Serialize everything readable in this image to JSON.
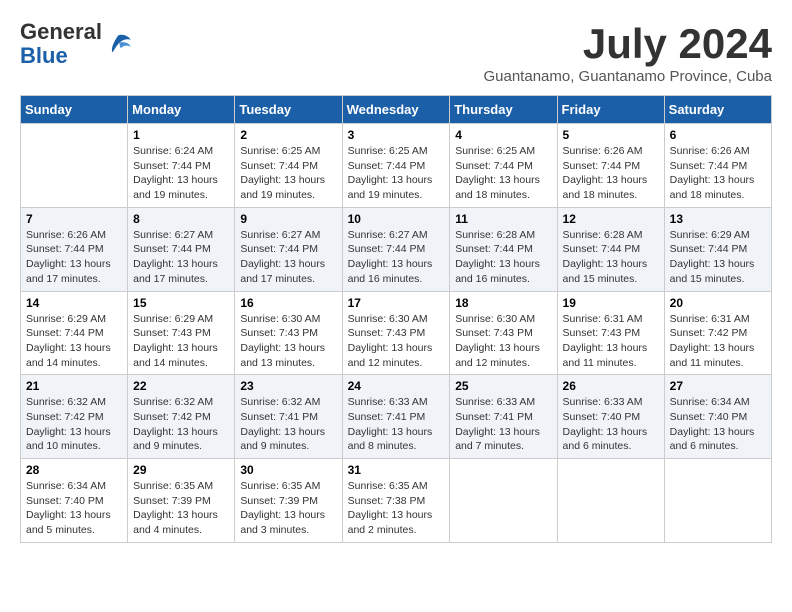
{
  "header": {
    "logo_general": "General",
    "logo_blue": "Blue",
    "month_title": "July 2024",
    "subtitle": "Guantanamo, Guantanamo Province, Cuba"
  },
  "days_of_week": [
    "Sunday",
    "Monday",
    "Tuesday",
    "Wednesday",
    "Thursday",
    "Friday",
    "Saturday"
  ],
  "weeks": [
    [
      {
        "day": "",
        "info": ""
      },
      {
        "day": "1",
        "info": "Sunrise: 6:24 AM\nSunset: 7:44 PM\nDaylight: 13 hours\nand 19 minutes."
      },
      {
        "day": "2",
        "info": "Sunrise: 6:25 AM\nSunset: 7:44 PM\nDaylight: 13 hours\nand 19 minutes."
      },
      {
        "day": "3",
        "info": "Sunrise: 6:25 AM\nSunset: 7:44 PM\nDaylight: 13 hours\nand 19 minutes."
      },
      {
        "day": "4",
        "info": "Sunrise: 6:25 AM\nSunset: 7:44 PM\nDaylight: 13 hours\nand 18 minutes."
      },
      {
        "day": "5",
        "info": "Sunrise: 6:26 AM\nSunset: 7:44 PM\nDaylight: 13 hours\nand 18 minutes."
      },
      {
        "day": "6",
        "info": "Sunrise: 6:26 AM\nSunset: 7:44 PM\nDaylight: 13 hours\nand 18 minutes."
      }
    ],
    [
      {
        "day": "7",
        "info": "Sunrise: 6:26 AM\nSunset: 7:44 PM\nDaylight: 13 hours\nand 17 minutes."
      },
      {
        "day": "8",
        "info": "Sunrise: 6:27 AM\nSunset: 7:44 PM\nDaylight: 13 hours\nand 17 minutes."
      },
      {
        "day": "9",
        "info": "Sunrise: 6:27 AM\nSunset: 7:44 PM\nDaylight: 13 hours\nand 17 minutes."
      },
      {
        "day": "10",
        "info": "Sunrise: 6:27 AM\nSunset: 7:44 PM\nDaylight: 13 hours\nand 16 minutes."
      },
      {
        "day": "11",
        "info": "Sunrise: 6:28 AM\nSunset: 7:44 PM\nDaylight: 13 hours\nand 16 minutes."
      },
      {
        "day": "12",
        "info": "Sunrise: 6:28 AM\nSunset: 7:44 PM\nDaylight: 13 hours\nand 15 minutes."
      },
      {
        "day": "13",
        "info": "Sunrise: 6:29 AM\nSunset: 7:44 PM\nDaylight: 13 hours\nand 15 minutes."
      }
    ],
    [
      {
        "day": "14",
        "info": "Sunrise: 6:29 AM\nSunset: 7:44 PM\nDaylight: 13 hours\nand 14 minutes."
      },
      {
        "day": "15",
        "info": "Sunrise: 6:29 AM\nSunset: 7:43 PM\nDaylight: 13 hours\nand 14 minutes."
      },
      {
        "day": "16",
        "info": "Sunrise: 6:30 AM\nSunset: 7:43 PM\nDaylight: 13 hours\nand 13 minutes."
      },
      {
        "day": "17",
        "info": "Sunrise: 6:30 AM\nSunset: 7:43 PM\nDaylight: 13 hours\nand 12 minutes."
      },
      {
        "day": "18",
        "info": "Sunrise: 6:30 AM\nSunset: 7:43 PM\nDaylight: 13 hours\nand 12 minutes."
      },
      {
        "day": "19",
        "info": "Sunrise: 6:31 AM\nSunset: 7:43 PM\nDaylight: 13 hours\nand 11 minutes."
      },
      {
        "day": "20",
        "info": "Sunrise: 6:31 AM\nSunset: 7:42 PM\nDaylight: 13 hours\nand 11 minutes."
      }
    ],
    [
      {
        "day": "21",
        "info": "Sunrise: 6:32 AM\nSunset: 7:42 PM\nDaylight: 13 hours\nand 10 minutes."
      },
      {
        "day": "22",
        "info": "Sunrise: 6:32 AM\nSunset: 7:42 PM\nDaylight: 13 hours\nand 9 minutes."
      },
      {
        "day": "23",
        "info": "Sunrise: 6:32 AM\nSunset: 7:41 PM\nDaylight: 13 hours\nand 9 minutes."
      },
      {
        "day": "24",
        "info": "Sunrise: 6:33 AM\nSunset: 7:41 PM\nDaylight: 13 hours\nand 8 minutes."
      },
      {
        "day": "25",
        "info": "Sunrise: 6:33 AM\nSunset: 7:41 PM\nDaylight: 13 hours\nand 7 minutes."
      },
      {
        "day": "26",
        "info": "Sunrise: 6:33 AM\nSunset: 7:40 PM\nDaylight: 13 hours\nand 6 minutes."
      },
      {
        "day": "27",
        "info": "Sunrise: 6:34 AM\nSunset: 7:40 PM\nDaylight: 13 hours\nand 6 minutes."
      }
    ],
    [
      {
        "day": "28",
        "info": "Sunrise: 6:34 AM\nSunset: 7:40 PM\nDaylight: 13 hours\nand 5 minutes."
      },
      {
        "day": "29",
        "info": "Sunrise: 6:35 AM\nSunset: 7:39 PM\nDaylight: 13 hours\nand 4 minutes."
      },
      {
        "day": "30",
        "info": "Sunrise: 6:35 AM\nSunset: 7:39 PM\nDaylight: 13 hours\nand 3 minutes."
      },
      {
        "day": "31",
        "info": "Sunrise: 6:35 AM\nSunset: 7:38 PM\nDaylight: 13 hours\nand 2 minutes."
      },
      {
        "day": "",
        "info": ""
      },
      {
        "day": "",
        "info": ""
      },
      {
        "day": "",
        "info": ""
      }
    ]
  ]
}
